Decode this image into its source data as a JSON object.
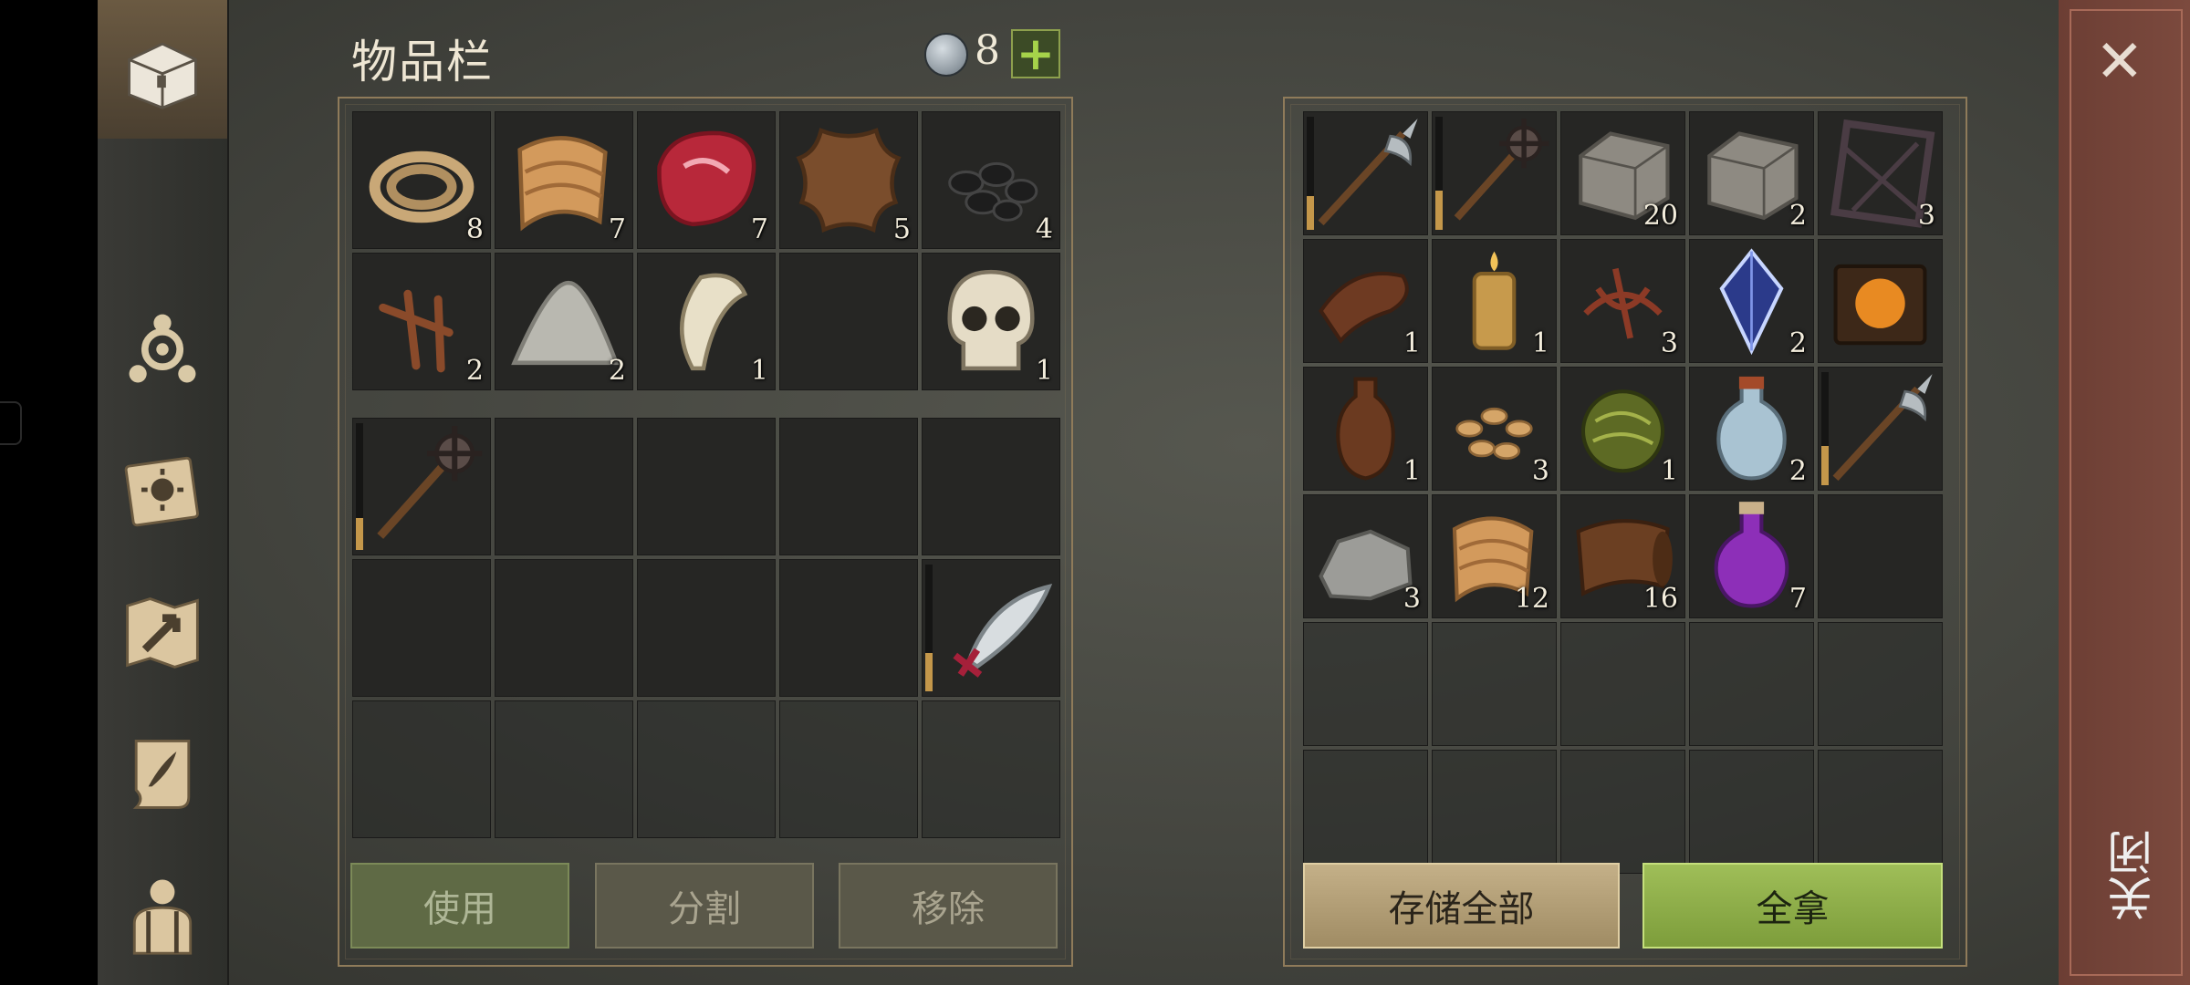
{
  "inventory": {
    "title": "物品栏",
    "currency_value": "8",
    "plus_label": "+"
  },
  "inventory_items": [
    {
      "icon": "rope-icon",
      "count": "8"
    },
    {
      "icon": "cloth-icon",
      "count": "7"
    },
    {
      "icon": "raw-meat-icon",
      "count": "7"
    },
    {
      "icon": "leather-hide-icon",
      "count": "5"
    },
    {
      "icon": "coal-icon",
      "count": "4"
    },
    {
      "icon": "nails-icon",
      "count": "2"
    },
    {
      "icon": "powder-pile-icon",
      "count": "2"
    },
    {
      "icon": "fang-icon",
      "count": "1"
    },
    {
      "icon": "",
      "count": ""
    },
    {
      "icon": "skull-icon",
      "count": "1"
    }
  ],
  "equipment_items": [
    {
      "icon": "mace-icon",
      "durability": 0.25
    },
    {
      "icon": "scimitar-icon",
      "durability": 0.3
    }
  ],
  "storage_items": [
    {
      "icon": "halberd-icon",
      "count": "",
      "durability": 0.3
    },
    {
      "icon": "mace-icon",
      "count": "",
      "durability": 0.35
    },
    {
      "icon": "stone-block-icon",
      "count": "20"
    },
    {
      "icon": "stone-block-icon",
      "count": "2"
    },
    {
      "icon": "iron-grate-icon",
      "count": "3"
    },
    {
      "icon": "leather-strip-icon",
      "count": "1"
    },
    {
      "icon": "candle-icon",
      "count": "1"
    },
    {
      "icon": "dried-root-icon",
      "count": "3"
    },
    {
      "icon": "crystal-shard-icon",
      "count": "2"
    },
    {
      "icon": "rune-book-icon",
      "count": ""
    },
    {
      "icon": "clay-bottle-icon",
      "count": "1"
    },
    {
      "icon": "seeds-icon",
      "count": "3"
    },
    {
      "icon": "herb-ball-icon",
      "count": "1"
    },
    {
      "icon": "water-flask-icon",
      "count": "2"
    },
    {
      "icon": "halberd-icon",
      "count": "",
      "durability": 0.35
    },
    {
      "icon": "iron-ore-icon",
      "count": "3"
    },
    {
      "icon": "cloth-icon",
      "count": "12"
    },
    {
      "icon": "leather-roll-icon",
      "count": "16"
    },
    {
      "icon": "purple-potion-icon",
      "count": "7"
    }
  ],
  "buttons": {
    "use": "使用",
    "split": "分割",
    "remove": "移除",
    "store_all": "存储全部",
    "take_all": "全拿",
    "close": "关闭"
  },
  "sidebar": [
    "chest-icon",
    "crafting-icon",
    "journal-icon",
    "map-icon",
    "scroll-icon",
    "character-icon"
  ],
  "colors": {
    "accent_green": "#9fbe58",
    "accent_tan": "#c4b088",
    "close_panel": "#7c4a3e"
  }
}
